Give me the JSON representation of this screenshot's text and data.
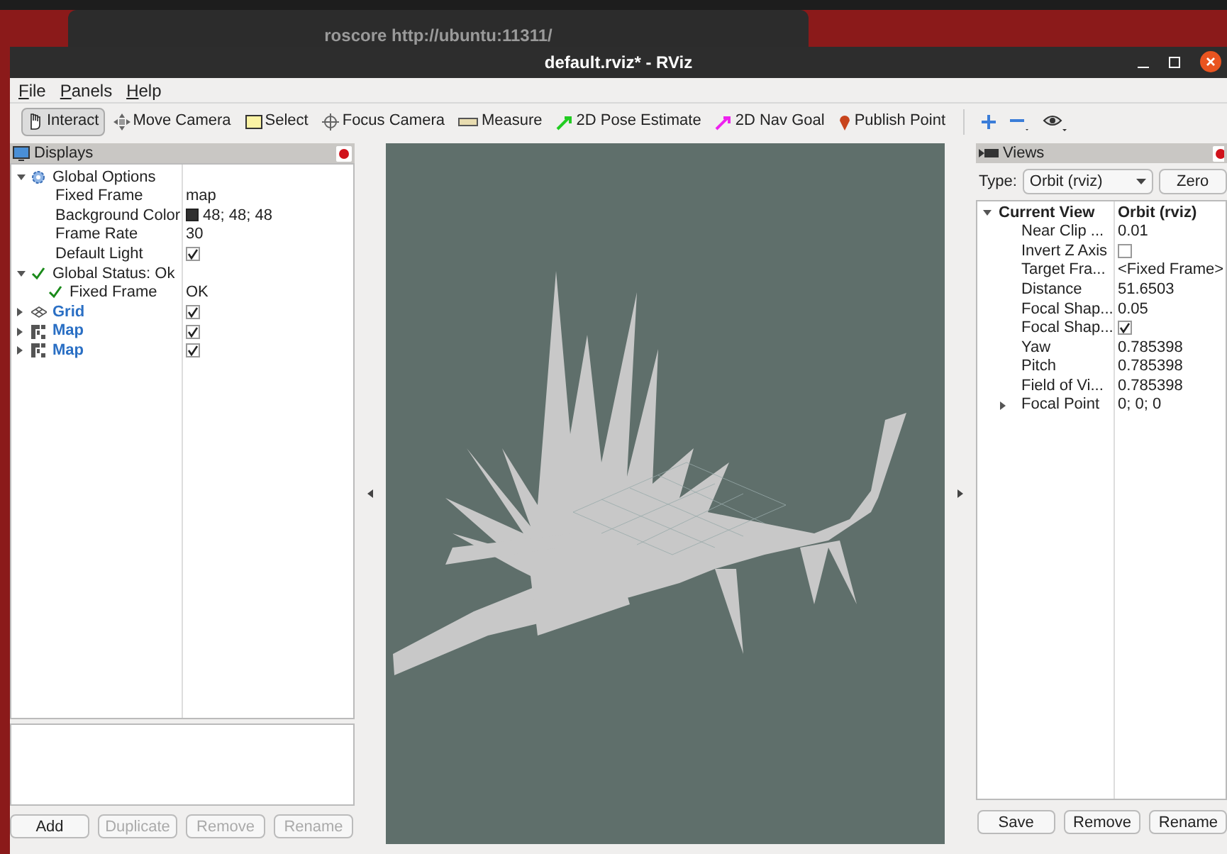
{
  "background_window": {
    "title": "roscore http://ubuntu:11311/"
  },
  "window": {
    "title": "default.rviz* - RViz"
  },
  "menu": [
    "File",
    "Panels",
    "Help"
  ],
  "toolbar": [
    {
      "label": "Interact",
      "kind": "hand",
      "selected": true
    },
    {
      "label": "Move Camera",
      "kind": "move",
      "selected": false
    },
    {
      "label": "Select",
      "kind": "select",
      "selected": false
    },
    {
      "label": "Focus Camera",
      "kind": "focus",
      "selected": false
    },
    {
      "label": "Measure",
      "kind": "ruler",
      "selected": false
    },
    {
      "label": "2D Pose Estimate",
      "kind": "pose",
      "selected": false
    },
    {
      "label": "2D Nav Goal",
      "kind": "goal",
      "selected": false
    },
    {
      "label": "Publish Point",
      "kind": "pin",
      "selected": false
    }
  ],
  "displays": {
    "title": "Displays",
    "tree": [
      {
        "label": "Global Options",
        "kind": "gear",
        "expanded": true,
        "children": [
          {
            "label": "Fixed Frame",
            "value": "map"
          },
          {
            "label": "Background Color",
            "value": "48; 48; 48",
            "color": "#303030"
          },
          {
            "label": "Frame Rate",
            "value": "30"
          },
          {
            "label": "Default Light",
            "checked": true
          }
        ]
      },
      {
        "label": "Global Status: Ok",
        "kind": "ok",
        "expanded": true,
        "children": [
          {
            "label": "Fixed Frame",
            "kind": "ok",
            "value": "OK"
          }
        ]
      },
      {
        "label": "Grid",
        "kind": "grid",
        "expanded": false,
        "enabled": true,
        "checked": true
      },
      {
        "label": "Map",
        "kind": "map",
        "expanded": false,
        "enabled": true,
        "checked": true
      },
      {
        "label": "Map",
        "kind": "map",
        "expanded": false,
        "enabled": true,
        "checked": true
      }
    ],
    "buttons": [
      {
        "label": "Add",
        "disabled": false
      },
      {
        "label": "Duplicate",
        "disabled": true
      },
      {
        "label": "Remove",
        "disabled": true
      },
      {
        "label": "Rename",
        "disabled": true
      }
    ]
  },
  "views": {
    "title": "Views",
    "type_label": "Type:",
    "type_value": "Orbit (rviz)",
    "zero_button": "Zero",
    "tree": [
      {
        "label": "Current View",
        "value": "Orbit (rviz)",
        "expanded": true,
        "children": [
          {
            "label": "Near Clip ...",
            "value": "0.01"
          },
          {
            "label": "Invert Z Axis",
            "checked": false
          },
          {
            "label": "Target Fra...",
            "value": "<Fixed Frame>"
          },
          {
            "label": "Distance",
            "value": "51.6503"
          },
          {
            "label": "Focal Shap...",
            "value": "0.05"
          },
          {
            "label": "Focal Shap...",
            "checked": true
          },
          {
            "label": "Yaw",
            "value": "0.785398"
          },
          {
            "label": "Pitch",
            "value": "0.785398"
          },
          {
            "label": "Field of Vi...",
            "value": "0.785398"
          },
          {
            "label": "Focal Point",
            "value": "0; 0; 0",
            "expanded": false
          }
        ]
      }
    ],
    "buttons": [
      {
        "label": "Save",
        "disabled": false
      },
      {
        "label": "Remove",
        "disabled": false
      },
      {
        "label": "Rename",
        "disabled": false
      }
    ]
  }
}
